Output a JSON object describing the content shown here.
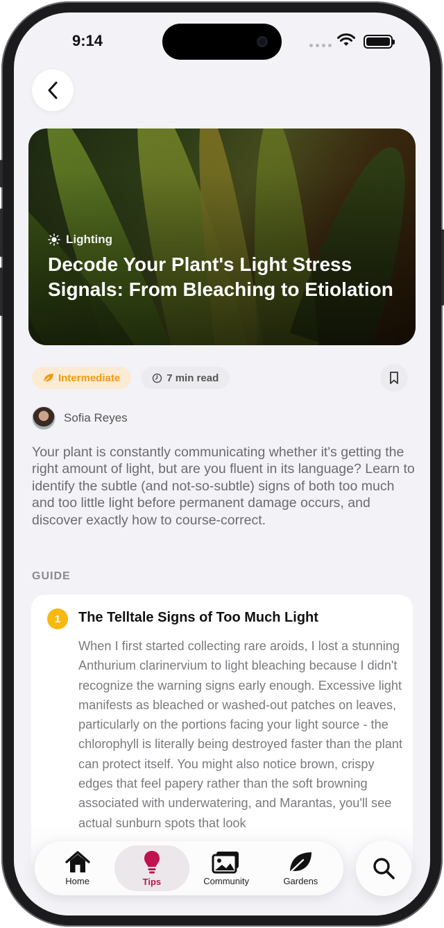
{
  "status": {
    "time": "9:14"
  },
  "hero": {
    "category": "Lighting",
    "category_icon": "sun-icon",
    "title": "Decode Your Plant's Light Stress Signals: From Bleaching to Etiolation"
  },
  "meta": {
    "level": "Intermediate",
    "level_icon": "leaf-icon",
    "level_color": "#f29a12",
    "read_time": "7 min read",
    "read_icon": "clock-icon"
  },
  "author": {
    "name": "Sofia Reyes"
  },
  "intro": "Your plant is constantly communicating whether it's getting the right amount of light, but are you fluent in its language? Learn to identify the subtle (and not-so-subtle) signs of both too much and too little light before permanent damage occurs, and discover exactly how to course-correct.",
  "section_label": "GUIDE",
  "steps": [
    {
      "number": "1",
      "title": "The Telltale Signs of Too Much Light",
      "body": "When I first started collecting rare aroids, I lost a stunning Anthurium clarinervium to light bleaching because I didn't recognize the warning signs early enough. Excessive light manifests as bleached or washed-out patches on leaves, particularly on the portions facing your light source - the chlorophyll is literally being destroyed faster than the plant can protect itself. You might also notice brown, crispy edges that feel papery rather than the soft browning associated with underwatering, and Marantas, you'll see actual sunburn spots that look"
    }
  ],
  "tabbar": {
    "accent": "#c1124f",
    "tabs": [
      {
        "label": "Home",
        "icon": "home-icon"
      },
      {
        "label": "Tips",
        "icon": "lightbulb-icon"
      },
      {
        "label": "Community",
        "icon": "photos-icon"
      },
      {
        "label": "Gardens",
        "icon": "leaf-icon"
      }
    ]
  }
}
